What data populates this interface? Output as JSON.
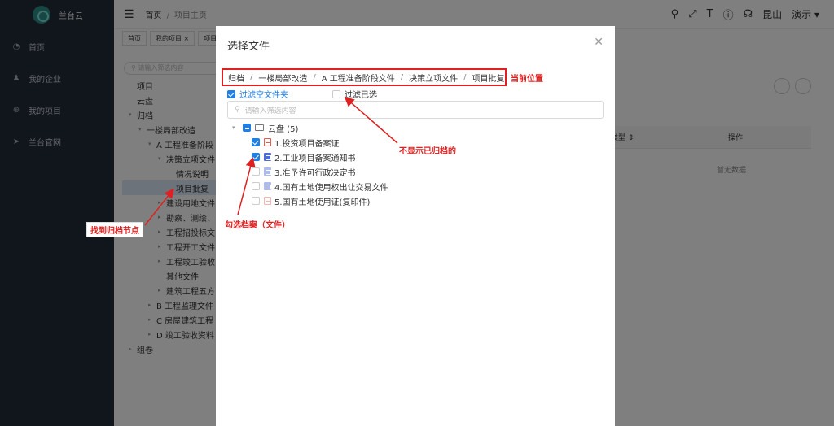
{
  "app": {
    "name": "兰台云"
  },
  "sidebar": {
    "items": [
      {
        "icon": "dashboard-icon",
        "label": "首页"
      },
      {
        "icon": "user-icon",
        "label": "我的企业"
      },
      {
        "icon": "plus-circle-icon",
        "label": "我的项目"
      },
      {
        "icon": "send-icon",
        "label": "兰台官网"
      }
    ]
  },
  "header": {
    "breadcrumb": [
      "首页",
      "项目主页"
    ],
    "location": "昆山",
    "user": "演示",
    "icons": [
      "search-icon",
      "fullscreen-icon",
      "font-size-icon",
      "help-icon",
      "headset-icon"
    ]
  },
  "tabs": [
    "首页",
    "我的项目",
    "项目主页"
  ],
  "background": {
    "search_placeholder": "请输入筛选内容",
    "tree": [
      {
        "label": "项目",
        "level": 0,
        "arrow": ""
      },
      {
        "label": "云盘",
        "level": 0,
        "arrow": ""
      },
      {
        "label": "归档",
        "level": 0,
        "arrow": "▾"
      },
      {
        "label": "一楼局部改造",
        "level": 1,
        "arrow": "▾"
      },
      {
        "label": "A 工程准备阶段",
        "level": 2,
        "arrow": "▾"
      },
      {
        "label": "决策立项文件",
        "level": 3,
        "arrow": "▾"
      },
      {
        "label": "情况说明",
        "level": 4,
        "arrow": ""
      },
      {
        "label": "项目批复",
        "level": 4,
        "arrow": "",
        "selected": true
      },
      {
        "label": "建设用地文件",
        "level": 3,
        "arrow": "▸"
      },
      {
        "label": "勘察、测绘、",
        "level": 3,
        "arrow": "▸"
      },
      {
        "label": "工程招投标文",
        "level": 3,
        "arrow": "▸"
      },
      {
        "label": "工程开工文件",
        "level": 3,
        "arrow": "▸"
      },
      {
        "label": "工程竣工验收",
        "level": 3,
        "arrow": "▸"
      },
      {
        "label": "其他文件",
        "level": 3,
        "arrow": ""
      },
      {
        "label": "建筑工程五方",
        "level": 3,
        "arrow": "▸"
      },
      {
        "label": "B 工程监理文件",
        "level": 2,
        "arrow": "▸"
      },
      {
        "label": "C 房屋建筑工程",
        "level": 2,
        "arrow": "▸"
      },
      {
        "label": "D 竣工验收资料",
        "level": 2,
        "arrow": "▸"
      },
      {
        "label": "组卷",
        "level": 0,
        "arrow": "▸"
      }
    ],
    "table_headers": [
      "类型",
      "操作"
    ],
    "empty_text": "暂无数据"
  },
  "modal": {
    "title": "选择文件",
    "path": [
      "归档",
      "一楼局部改造",
      "A 工程准备阶段文件",
      "决策立项文件",
      "项目批复"
    ],
    "filter_empty_folder": "过滤空文件夹",
    "filter_selected": "过滤已选",
    "search_placeholder": "请输入筛选内容",
    "root": {
      "label": "云盘 (5)"
    },
    "files": [
      {
        "label": "1.投资项目备案证",
        "type": "pdf",
        "checked": true
      },
      {
        "label": "2.工业项目备案通知书",
        "type": "word",
        "checked": true
      },
      {
        "label": "3.准予许可行政决定书",
        "type": "word",
        "checked": false
      },
      {
        "label": "4.国有土地使用权出让交易文件",
        "type": "word",
        "checked": false
      },
      {
        "label": "5.国有土地使用证(复印件)",
        "type": "pdf",
        "checked": false
      }
    ]
  },
  "annotations": {
    "current_position": "当前位置",
    "not_show_archived": "不显示已归档的",
    "check_files": "勾选档案（文件）",
    "find_node": "找到归档节点"
  }
}
